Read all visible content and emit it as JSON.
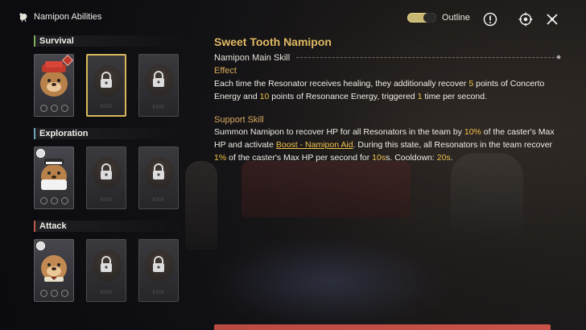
{
  "header": {
    "title": "Namipon Abilities",
    "outline_label": "Outline",
    "outline_on": true
  },
  "sections": [
    {
      "label": "Survival",
      "color": "#7fae5a"
    },
    {
      "label": "Exploration",
      "color": "#6fa2b8"
    },
    {
      "label": "Attack",
      "color": "#c0564b"
    }
  ],
  "detail": {
    "name": "Sweet Tooth Namipon",
    "main_skill_label": "Namipon Main Skill",
    "effect_heading": "Effect",
    "effect": {
      "t1": "Each time the Resonator receives healing, they additionally recover ",
      "v1": "5",
      "t2": " points of Concerto Energy and ",
      "v2": "10",
      "t3": " points of Resonance Energy, triggered ",
      "v3": "1",
      "t4": " time per second."
    },
    "support_heading": "Support Skill",
    "support": {
      "t1": "Summon Namipon to recover HP for all Resonators in the team by ",
      "v1": "10%",
      "t2": " of the caster's Max HP and activate ",
      "link": "Boost - Namipon Aid",
      "t3": ". During this state, all Resonators in the team recover ",
      "v2": "1%",
      "t4": " of the caster's Max HP per second for ",
      "v3": "10s",
      "t5": "s. Cooldown: ",
      "v4": "20s",
      "t6": "."
    }
  },
  "colors": {
    "accent_gold": "#e0b862",
    "highlight": "#f1c24d",
    "selected_border": "#d9b85a"
  }
}
